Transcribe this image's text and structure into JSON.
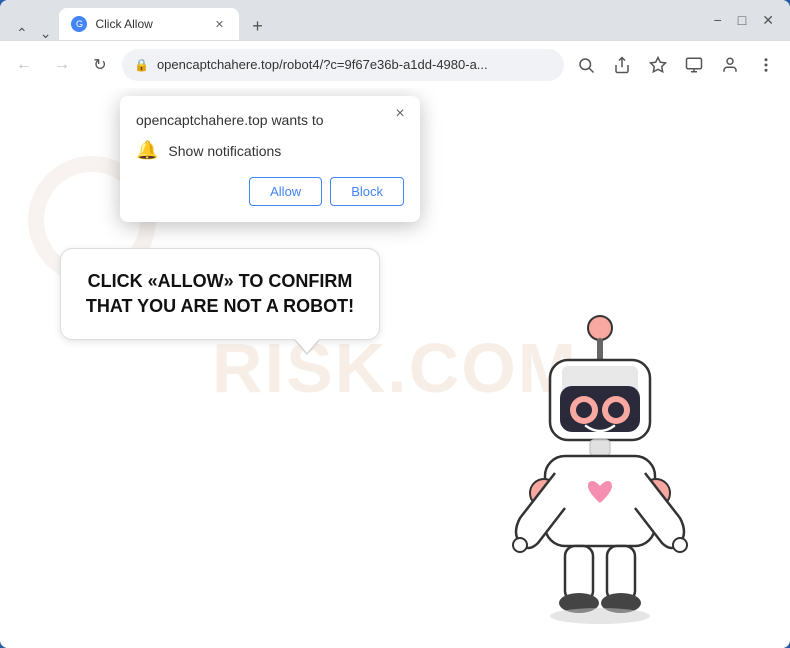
{
  "browser": {
    "tab": {
      "title": "Click Allow",
      "favicon_label": "G"
    },
    "window_controls": {
      "minimize": "−",
      "maximize": "□",
      "close": "✕",
      "chevron_down": "⌄",
      "chevron_up": "⌃"
    },
    "nav": {
      "back": "←",
      "forward": "→",
      "refresh": "↻",
      "address": "opencaptchahere.top/robot4/?c=9f67e36b-a1dd-4980-a...",
      "lock_icon": "🔒"
    },
    "nav_actions": {
      "search": "🔍",
      "share": "⬆",
      "bookmark": "☆",
      "cast": "▭",
      "profile": "👤",
      "menu": "⋮"
    }
  },
  "notification_popup": {
    "title": "opencaptchahere.top wants to",
    "notification_item": "Show notifications",
    "allow_label": "Allow",
    "block_label": "Block",
    "close": "×"
  },
  "page": {
    "bubble_text": "CLICK «ALLOW» TO CONFIRM THAT YOU ARE NOT A ROBOT!",
    "watermark": "RISK.COM"
  }
}
